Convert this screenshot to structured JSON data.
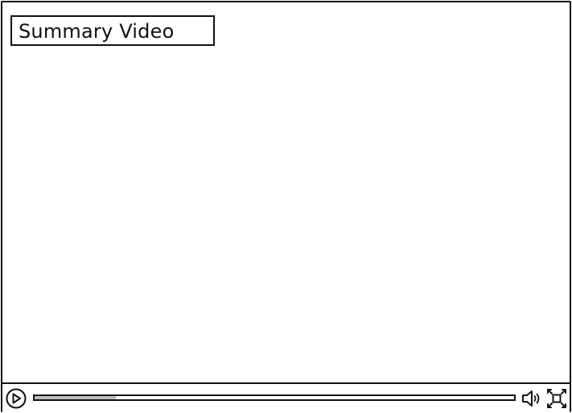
{
  "video": {
    "title": "Summary Video",
    "progress": 0.17
  },
  "controls": {
    "play_icon": "play-icon",
    "volume_icon": "volume-icon",
    "fullscreen_icon": "fullscreen-icon"
  }
}
